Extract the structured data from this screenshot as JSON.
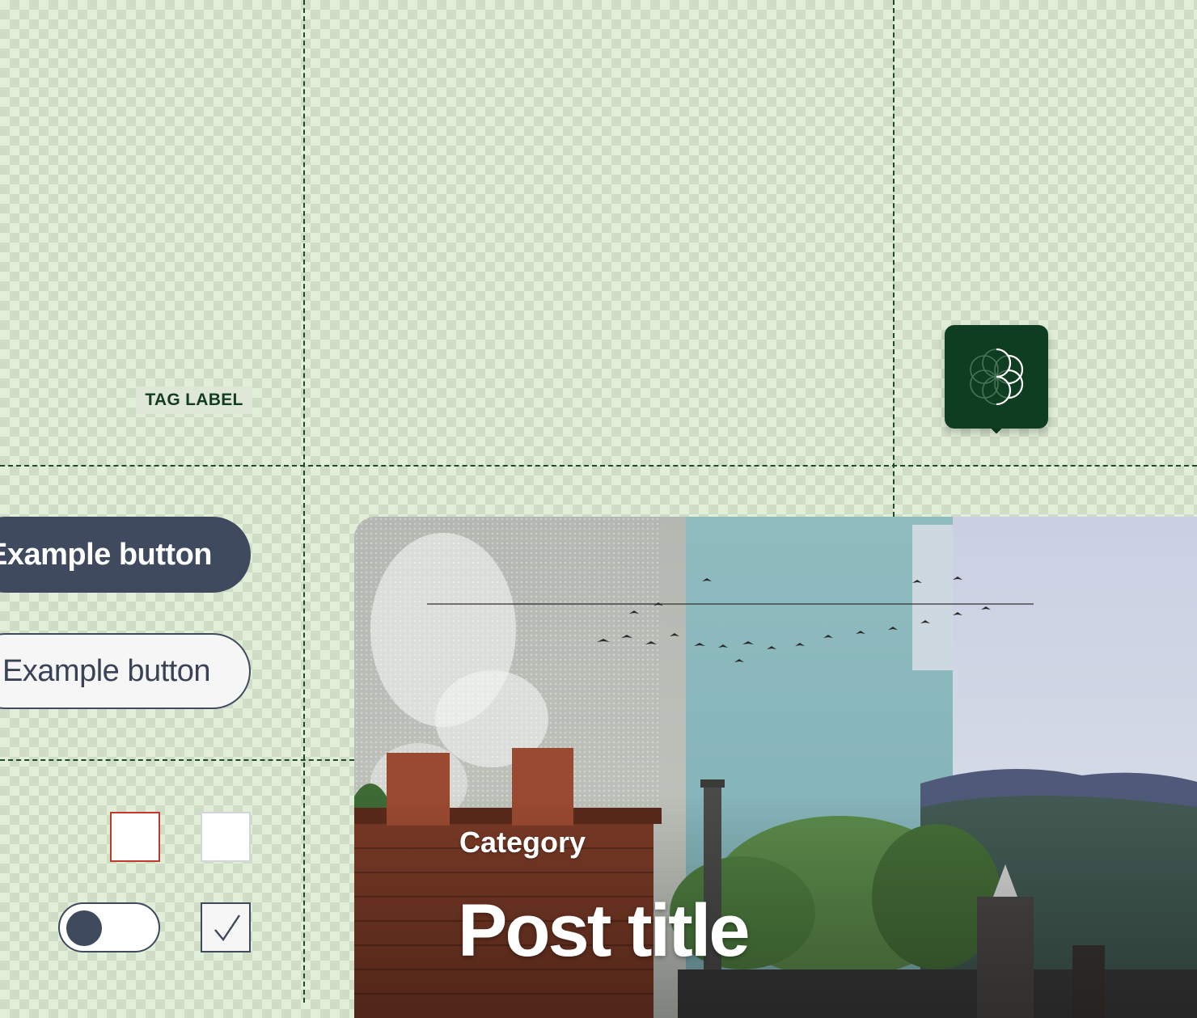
{
  "tag": {
    "label": "TAG LABEL"
  },
  "buttons": {
    "primary_label": "Example button",
    "secondary_label": "Example button"
  },
  "post": {
    "category": "Category",
    "title": "Post title"
  },
  "controls": {
    "toggle_state": "on",
    "checkbox_checked": true,
    "checkbox_error": true
  },
  "colors": {
    "background": "#e1eed8",
    "checker": "#cfdcc6",
    "guide": "#1f4a2a",
    "brand_dark_green": "#0f3d22",
    "slate": "#3f4a5f",
    "error_red": "#c0392b",
    "white": "#ffffff"
  },
  "icons": {
    "app_badge": "flower-of-life-logo-icon",
    "checkmark": "checkmark-icon"
  }
}
